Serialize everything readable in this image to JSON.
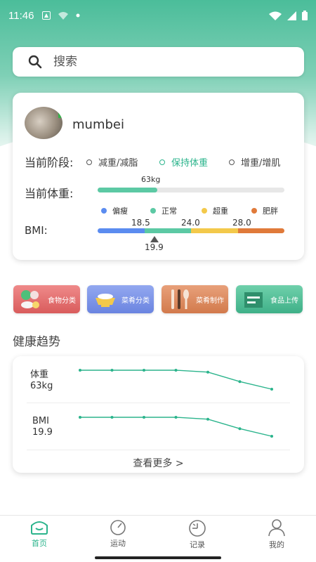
{
  "status_bar": {
    "time": "11:46"
  },
  "search": {
    "placeholder": "搜索"
  },
  "profile": {
    "username": "mumbei",
    "stage_label": "当前阶段:",
    "stages": [
      {
        "label": "减重/减脂",
        "active": false
      },
      {
        "label": "保持体重",
        "active": true
      },
      {
        "label": "增重/增肌",
        "active": false
      }
    ],
    "weight_label": "当前体重:",
    "weight_value": "63kg",
    "weight_progress": 0.32,
    "bmi_label": "BMI:",
    "bmi_legend": [
      {
        "label": "偏瘦",
        "color": "#5b8cf0"
      },
      {
        "label": "正常",
        "color": "#5cc9a4"
      },
      {
        "label": "超重",
        "color": "#f3c94b"
      },
      {
        "label": "肥胖",
        "color": "#e07a3a"
      }
    ],
    "bmi_ticks": [
      "18.5",
      "24.0",
      "28.0"
    ],
    "bmi_value": "19.9"
  },
  "categories": [
    {
      "label": "食物分类",
      "icon": "food-category-icon",
      "color": "#e86f6f"
    },
    {
      "label": "菜肴分类",
      "icon": "dish-category-icon",
      "color": "#7d95e8"
    },
    {
      "label": "菜肴制作",
      "icon": "cooking-icon",
      "color": "#dc8a5d"
    },
    {
      "label": "食品上传",
      "icon": "upload-icon",
      "color": "#4fc096"
    }
  ],
  "trend": {
    "title": "健康趋势",
    "weight_label": "体重",
    "weight_value": "63kg",
    "bmi_label": "BMI",
    "bmi_value": "19.9",
    "more_label": "查看更多 >",
    "weight_points": [
      0,
      0,
      0,
      0,
      0.1,
      0.6,
      1.0
    ],
    "bmi_points": [
      0,
      0,
      0,
      0,
      0.1,
      0.6,
      1.0
    ]
  },
  "tabbar": {
    "items": [
      {
        "label": "首页",
        "icon": "home-icon",
        "active": true
      },
      {
        "label": "运动",
        "icon": "speedometer-icon",
        "active": false
      },
      {
        "label": "记录",
        "icon": "record-clock-icon",
        "active": false
      },
      {
        "label": "我的",
        "icon": "profile-icon",
        "active": false
      }
    ]
  },
  "colors": {
    "accent": "#2bb48c",
    "line": "#2bb48c"
  }
}
